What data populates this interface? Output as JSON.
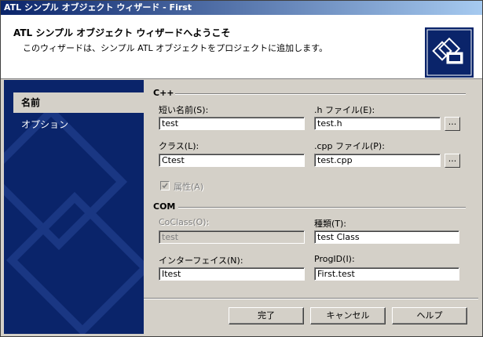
{
  "window": {
    "title": "ATL シンプル オブジェクト ウィザード - First"
  },
  "header": {
    "title": "ATL シンプル オブジェクト ウィザードへようこそ",
    "subtitle": "このウィザードは、シンプル ATL オブジェクトをプロジェクトに追加します。",
    "logo_icon": "wizard-logo-icon"
  },
  "sidebar": {
    "items": [
      {
        "label": "名前",
        "selected": true
      },
      {
        "label": "オプション",
        "selected": false
      }
    ]
  },
  "cpp_group": {
    "label": "C++",
    "short_name": {
      "label": "短い名前(S):",
      "value": "test"
    },
    "h_file": {
      "label": ".h ファイル(E):",
      "value": "test.h"
    },
    "class": {
      "label": "クラス(L):",
      "value": "Ctest"
    },
    "cpp_file": {
      "label": ".cpp ファイル(P):",
      "value": "test.cpp"
    },
    "browse_label": "...",
    "attributed": {
      "label": "属性(A)",
      "checked": true,
      "enabled": false
    }
  },
  "com_group": {
    "label": "COM",
    "coclass": {
      "label": "CoClass(O):",
      "value": "test",
      "enabled": false
    },
    "type": {
      "label": "種類(T):",
      "value": "test Class"
    },
    "interface": {
      "label": "インターフェイス(N):",
      "value": "Itest"
    },
    "progid": {
      "label": "ProgID(I):",
      "value": "First.test"
    }
  },
  "footer": {
    "finish_label": "完了",
    "cancel_label": "キャンセル",
    "help_label": "ヘルプ"
  },
  "colors": {
    "sidebar_bg": "#0a246a",
    "titlebar_start": "#0a246a",
    "titlebar_end": "#a6caf0",
    "dialog_bg": "#d4d0c8"
  }
}
